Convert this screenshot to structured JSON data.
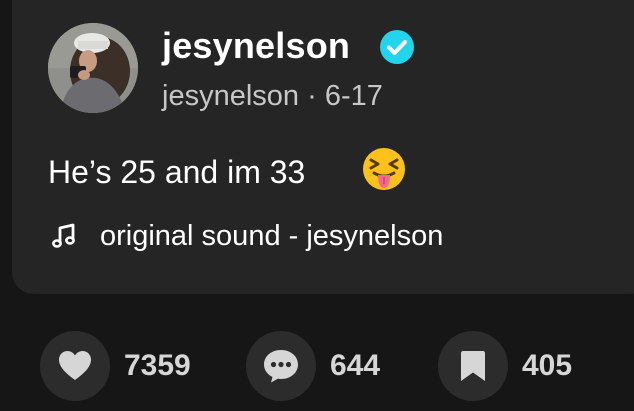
{
  "post": {
    "username": "jesynelson",
    "verified": true,
    "handle": "jesynelson",
    "separator": "·",
    "date": "6-17",
    "caption": "He’s 25 and im 33",
    "emoji": "squinting-face-with-tongue",
    "sound": {
      "icon": "music-note-icon",
      "label": "original sound - jesynelson"
    }
  },
  "actions": {
    "likes": {
      "icon": "heart-icon",
      "count": "7359"
    },
    "comments": {
      "icon": "comment-bubble-icon",
      "count": "644"
    },
    "saves": {
      "icon": "bookmark-icon",
      "count": "405"
    }
  },
  "colors": {
    "background": "#161616",
    "card": "#252525",
    "verified_badge": "#20d5ec",
    "action_circle": "#2c2c2c"
  }
}
